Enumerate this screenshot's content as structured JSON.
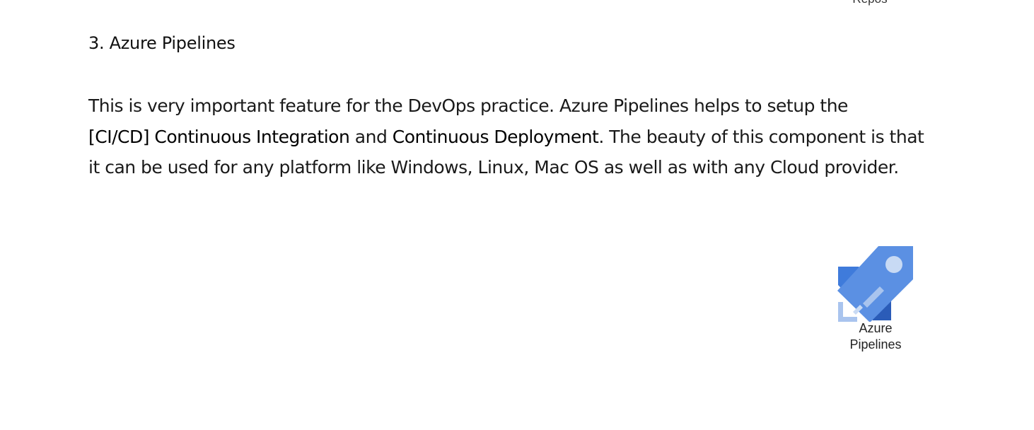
{
  "previous_logo": {
    "caption": "Repos"
  },
  "section": {
    "heading": "3. Azure Pipelines",
    "paragraph": {
      "sentence_1": "This is very important feature for the DevOps practice. Azure Pipelines helps to setup the",
      "emphasis_1": "[CI/CD] Continuous Integration",
      "connector": "and",
      "emphasis_2": "Continuous Deployment",
      "sentence_2": ". The beauty of this component is that it can be used for any platform like Windows, Linux, Mac OS as well as with any Cloud provider."
    }
  },
  "logo": {
    "icon": "azure-pipelines-rocket-icon",
    "caption_line_1": "Azure",
    "caption_line_2": "Pipelines",
    "colors": {
      "primary": "#3F7BDB",
      "dark": "#2B5CB8",
      "light": "#A9C4EE",
      "window": "#C8DAF4"
    }
  }
}
